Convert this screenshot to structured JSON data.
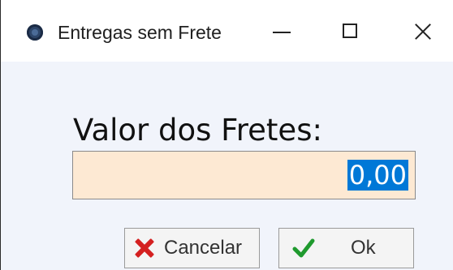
{
  "window": {
    "title": "Entregas sem Frete",
    "app_icon": "app-logo-icon",
    "controls": {
      "minimize": "minimize-icon",
      "maximize": "maximize-icon",
      "close": "close-icon"
    }
  },
  "form": {
    "label": "Valor dos Fretes:",
    "value": "0,00",
    "value_selected": true,
    "field_bg": "#fde9d3",
    "selection_color": "#0078d7"
  },
  "buttons": {
    "cancel": {
      "label": "Cancelar",
      "icon": "x-icon",
      "icon_color": "#d42020"
    },
    "ok": {
      "label": "Ok",
      "icon": "checkmark-icon",
      "icon_color": "#1f9a2e"
    }
  }
}
